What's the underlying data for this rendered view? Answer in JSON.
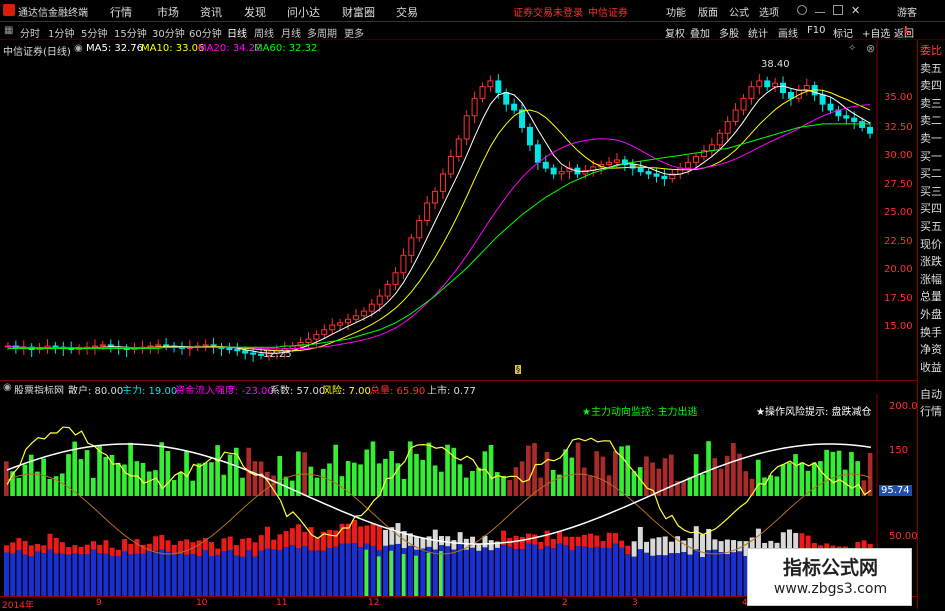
{
  "app": {
    "name": "通达信金融终端",
    "user": "游客",
    "login_status": "证券交易未登录",
    "broker": "中信证券"
  },
  "top_menu": [
    "行情",
    "市场",
    "资讯",
    "发现",
    "问小达",
    "财富圈",
    "交易"
  ],
  "top_right": [
    "功能",
    "版面",
    "公式",
    "选项"
  ],
  "periods": [
    "分时",
    "1分钟",
    "5分钟",
    "15分钟",
    "30分钟",
    "60分钟",
    "日线",
    "周线",
    "月线",
    "多周期",
    "更多"
  ],
  "right_toolbar": [
    "复权",
    "叠加",
    "多股",
    "统计",
    "画线",
    "F10",
    "标记",
    "+自选",
    "返回"
  ],
  "chart_header": {
    "title": "中信证券(日线)",
    "ma5": "MA5: 32.76",
    "ma10": "MA10: 33.06",
    "ma20": "MA20: 34.22",
    "ma60": "MA60: 32.32"
  },
  "price_axis": [
    "35.00",
    "32.50",
    "30.00",
    "27.50",
    "25.00",
    "22.50",
    "20.00",
    "17.50",
    "15.00"
  ],
  "price_marks": {
    "high": "38.40",
    "low": "12.25",
    "corner": "L"
  },
  "side_panel": [
    "委比",
    "卖五",
    "卖四",
    "卖三",
    "卖二",
    "卖一",
    "买一",
    "买二",
    "买三",
    "买四",
    "买五",
    "现价",
    "涨跌",
    "涨幅",
    "总量",
    "外盘",
    "换手",
    "净资",
    "收益",
    "自动",
    "行情"
  ],
  "indicator_header": {
    "name": "股票指标网",
    "sanhu": "散户: 80.00",
    "zhuli": "主力: 19.00",
    "zijin": "资金流入强度: -23.00",
    "xishu": "系数: 57.00",
    "fengxian": "风险: 7.00",
    "zongliang": "总量: 65.90",
    "shangshi": "上市: 0.77"
  },
  "indicator_notes": {
    "monitor": "★主力动向监控: 主力出逃",
    "risk": "★操作风险提示: 盘跌减仓"
  },
  "ind_axis": [
    "200.0",
    "150",
    "50.00"
  ],
  "ind_value": "95.74",
  "dates": [
    "2014年",
    "9",
    "10",
    "11",
    "12",
    "2",
    "3",
    "4"
  ],
  "watermark": {
    "title": "指标公式网",
    "url": "www.zbgs3.com"
  },
  "colors": {
    "up": "#ff3030",
    "down": "#00e5e5",
    "ma5": "#ffffff",
    "ma10": "#ffff00",
    "ma20": "#ff00ff",
    "ma60": "#00ff00",
    "frame": "#8a0000"
  },
  "chart_data": {
    "type": "candlestick",
    "ylim": [
      12,
      39
    ],
    "close": [
      13.2,
      13.0,
      13.1,
      12.9,
      13.0,
      13.2,
      13.1,
      13.0,
      12.9,
      13.0,
      13.1,
      13.2,
      13.3,
      13.1,
      13.0,
      12.9,
      13.0,
      13.1,
      13.2,
      13.3,
      13.2,
      13.1,
      13.0,
      13.1,
      13.2,
      13.3,
      13.1,
      13.0,
      12.9,
      12.8,
      12.6,
      12.5,
      12.4,
      12.6,
      12.8,
      13.0,
      13.2,
      13.5,
      13.8,
      14.2,
      14.6,
      15.0,
      15.2,
      15.5,
      15.8,
      16.2,
      16.8,
      17.5,
      18.5,
      19.5,
      21.0,
      22.5,
      24.0,
      25.5,
      26.5,
      28.0,
      29.5,
      31.0,
      33.0,
      34.5,
      35.5,
      36.0,
      35.0,
      34.0,
      33.5,
      32.0,
      30.5,
      29.0,
      28.5,
      28.0,
      28.2,
      28.5,
      28.0,
      28.3,
      28.6,
      28.8,
      29.0,
      29.2,
      28.8,
      28.5,
      28.2,
      28.0,
      27.8,
      27.6,
      28.0,
      28.5,
      29.0,
      29.5,
      30.0,
      30.5,
      31.5,
      32.5,
      33.5,
      34.5,
      35.5,
      36.0,
      35.5,
      35.8,
      35.0,
      34.5,
      35.2,
      35.6,
      34.8,
      34.0,
      33.5,
      33.0,
      32.8,
      32.5,
      32.0,
      31.5
    ],
    "ma60": [
      13.0,
      13.0,
      13.0,
      13.0,
      13.0,
      13.0,
      13.0,
      13.0,
      13.0,
      13.0,
      13.0,
      13.0,
      13.0,
      13.0,
      13.0,
      13.0,
      13.0,
      13.0,
      13.0,
      13.0,
      13.1,
      13.1,
      13.1,
      13.1,
      13.1,
      13.1,
      13.1,
      13.1,
      13.1,
      13.1,
      13.1,
      13.1,
      13.1,
      13.1,
      13.1,
      13.2,
      13.2,
      13.3,
      13.3,
      13.4,
      13.5,
      13.6,
      13.7,
      13.8,
      14.0,
      14.2,
      14.4,
      14.6,
      14.9,
      15.2,
      15.6,
      16.0,
      16.5,
      17.0,
      17.5,
      18.1,
      18.7,
      19.3,
      19.9,
      20.6,
      21.3,
      22.0,
      22.7,
      23.3,
      23.9,
      24.5,
      25.0,
      25.5,
      26.0,
      26.4,
      26.8,
      27.2,
      27.5,
      27.8,
      28.1,
      28.3,
      28.5,
      28.7,
      28.9,
      29.0,
      29.1,
      29.2,
      29.3,
      29.4,
      29.5,
      29.6,
      29.7,
      29.8,
      29.9,
      30.0,
      30.1,
      30.2,
      30.4,
      30.6,
      30.8,
      31.0,
      31.2,
      31.4,
      31.6,
      31.8,
      32.0,
      32.1,
      32.2,
      32.3,
      32.3,
      32.3,
      32.3,
      32.3,
      32.3,
      32.3
    ]
  }
}
